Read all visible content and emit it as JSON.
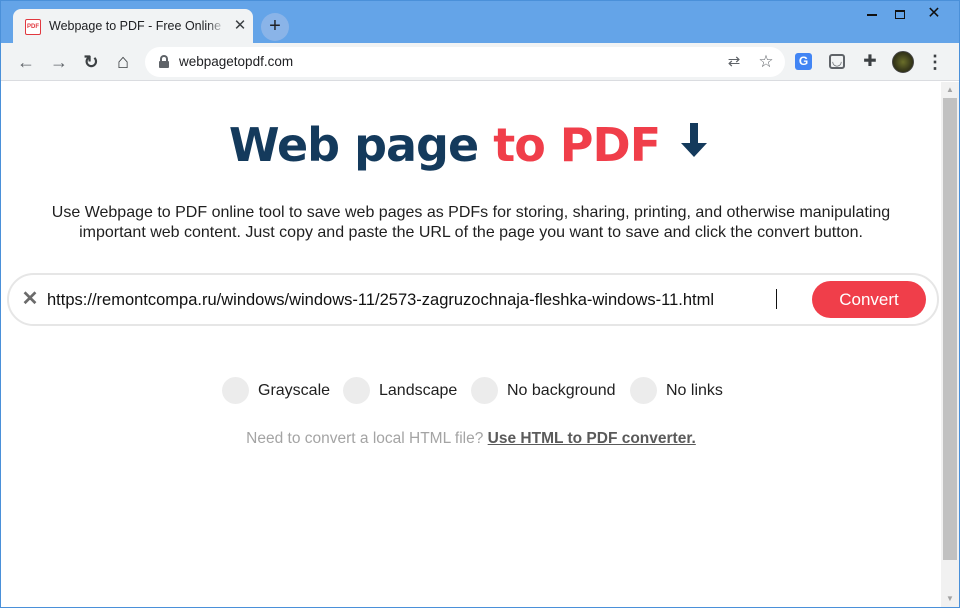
{
  "browser": {
    "tab": {
      "favicon_text": "PDF",
      "title": "Webpage to PDF - Free Online Co",
      "close": "✕"
    },
    "new_tab": "+",
    "window_controls": {
      "close": "✕"
    },
    "toolbar": {
      "back": "←",
      "forward": "→",
      "reload": "↻",
      "home": "⌂",
      "url": "webpagetopdf.com",
      "translate": "⇄",
      "bookmark": "☆",
      "menu": "⋮"
    },
    "extensions": {
      "google_translate": "G",
      "pocket": "◡",
      "puzzle": "✚"
    }
  },
  "page": {
    "hero": {
      "part1": "Web page ",
      "part2": "to PDF",
      "arrow": "🡇"
    },
    "intro": "Use Webpage to PDF online tool to save web pages as PDFs for storing, sharing, printing, and otherwise manipulating important web content. Just copy and paste the URL of the page you want to save and click the convert button.",
    "url_field": {
      "clear": "✕",
      "value": "https://remontcompa.ru/windows/windows-11/2573-zagruzochnaja-fleshka-windows-11.html"
    },
    "convert_label": "Convert",
    "options": [
      {
        "label": "Grayscale"
      },
      {
        "label": "Landscape"
      },
      {
        "label": "No background"
      },
      {
        "label": "No links"
      }
    ],
    "hint": {
      "text": "Need to convert a local HTML file? ",
      "link": "Use HTML to PDF converter."
    }
  },
  "colors": {
    "brand_dark": "#143a5c",
    "brand_red": "#f03e4a",
    "title_bar": "#64a4e8"
  }
}
